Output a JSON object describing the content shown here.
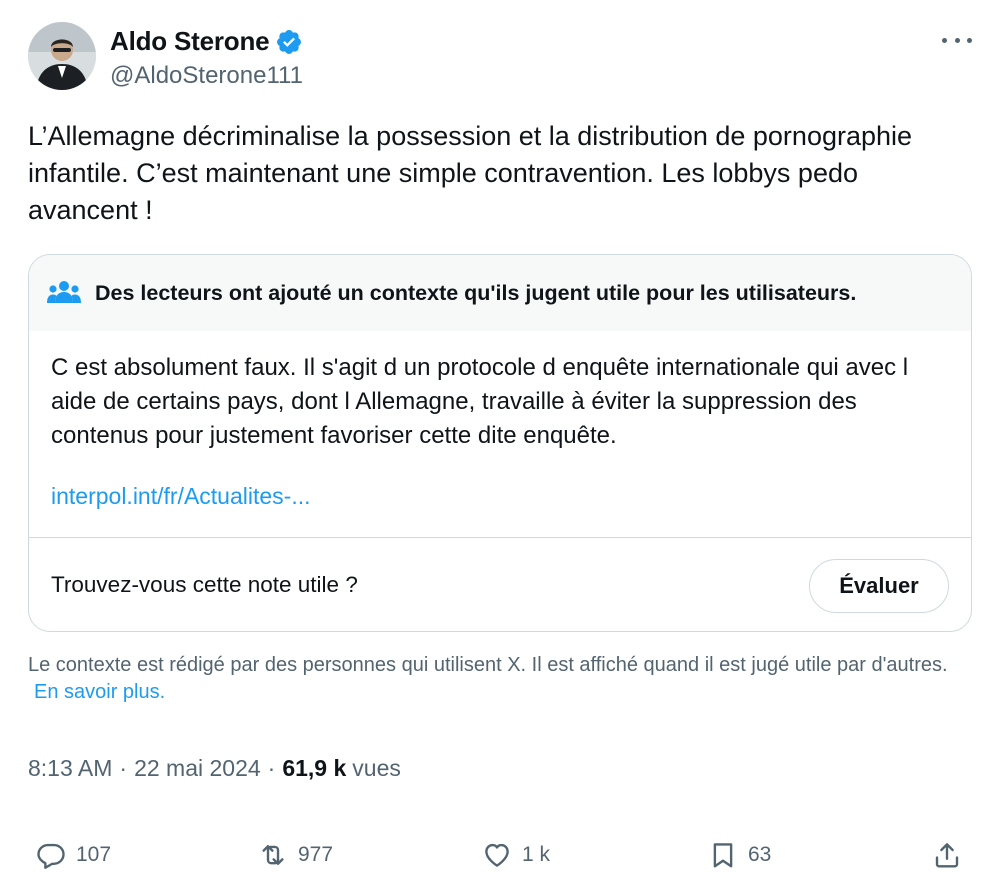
{
  "author": {
    "display_name": "Aldo Sterone",
    "handle": "@AldoSterone111",
    "verified": true
  },
  "tweet": {
    "text": "L’Allemagne décriminalise la possession et la distribution de pornographie infantile. C’est maintenant une simple contravention. Les lobbys pedo avancent !"
  },
  "community_note": {
    "header": "Des lecteurs ont ajouté un contexte qu'ils jugent utile pour les utilisateurs.",
    "body": "C est absolument faux. Il s'agit d un protocole d enquête internationale qui avec l aide de certains pays, dont l Allemagne, travaille à éviter la suppression des contenus pour justement favoriser cette dite enquête.",
    "link": "interpol.int/fr/Actualites-...",
    "question": "Trouvez-vous cette note utile ?",
    "rate_label": "Évaluer"
  },
  "disclaimer": {
    "text": "Le contexte est rédigé par des personnes qui utilisent X. Il est affiché quand il est jugé utile par d'autres.",
    "learn_more": "En savoir plus."
  },
  "meta": {
    "time": "8:13 AM",
    "date": "22 mai 2024",
    "separator": "·",
    "views_count": "61,9 k",
    "views_label": "vues"
  },
  "actions": {
    "replies": "107",
    "reposts": "977",
    "likes": "1 k",
    "bookmarks": "63"
  },
  "colors": {
    "accent": "#1d9bf0",
    "text_primary": "#0f1419",
    "text_secondary": "#536471",
    "border": "#cfd9de",
    "note_header_bg": "#f7f9f9"
  },
  "icons": [
    "more-icon",
    "verified-badge-icon",
    "community-notes-icon",
    "reply-icon",
    "repost-icon",
    "like-icon",
    "bookmark-icon",
    "share-icon"
  ]
}
